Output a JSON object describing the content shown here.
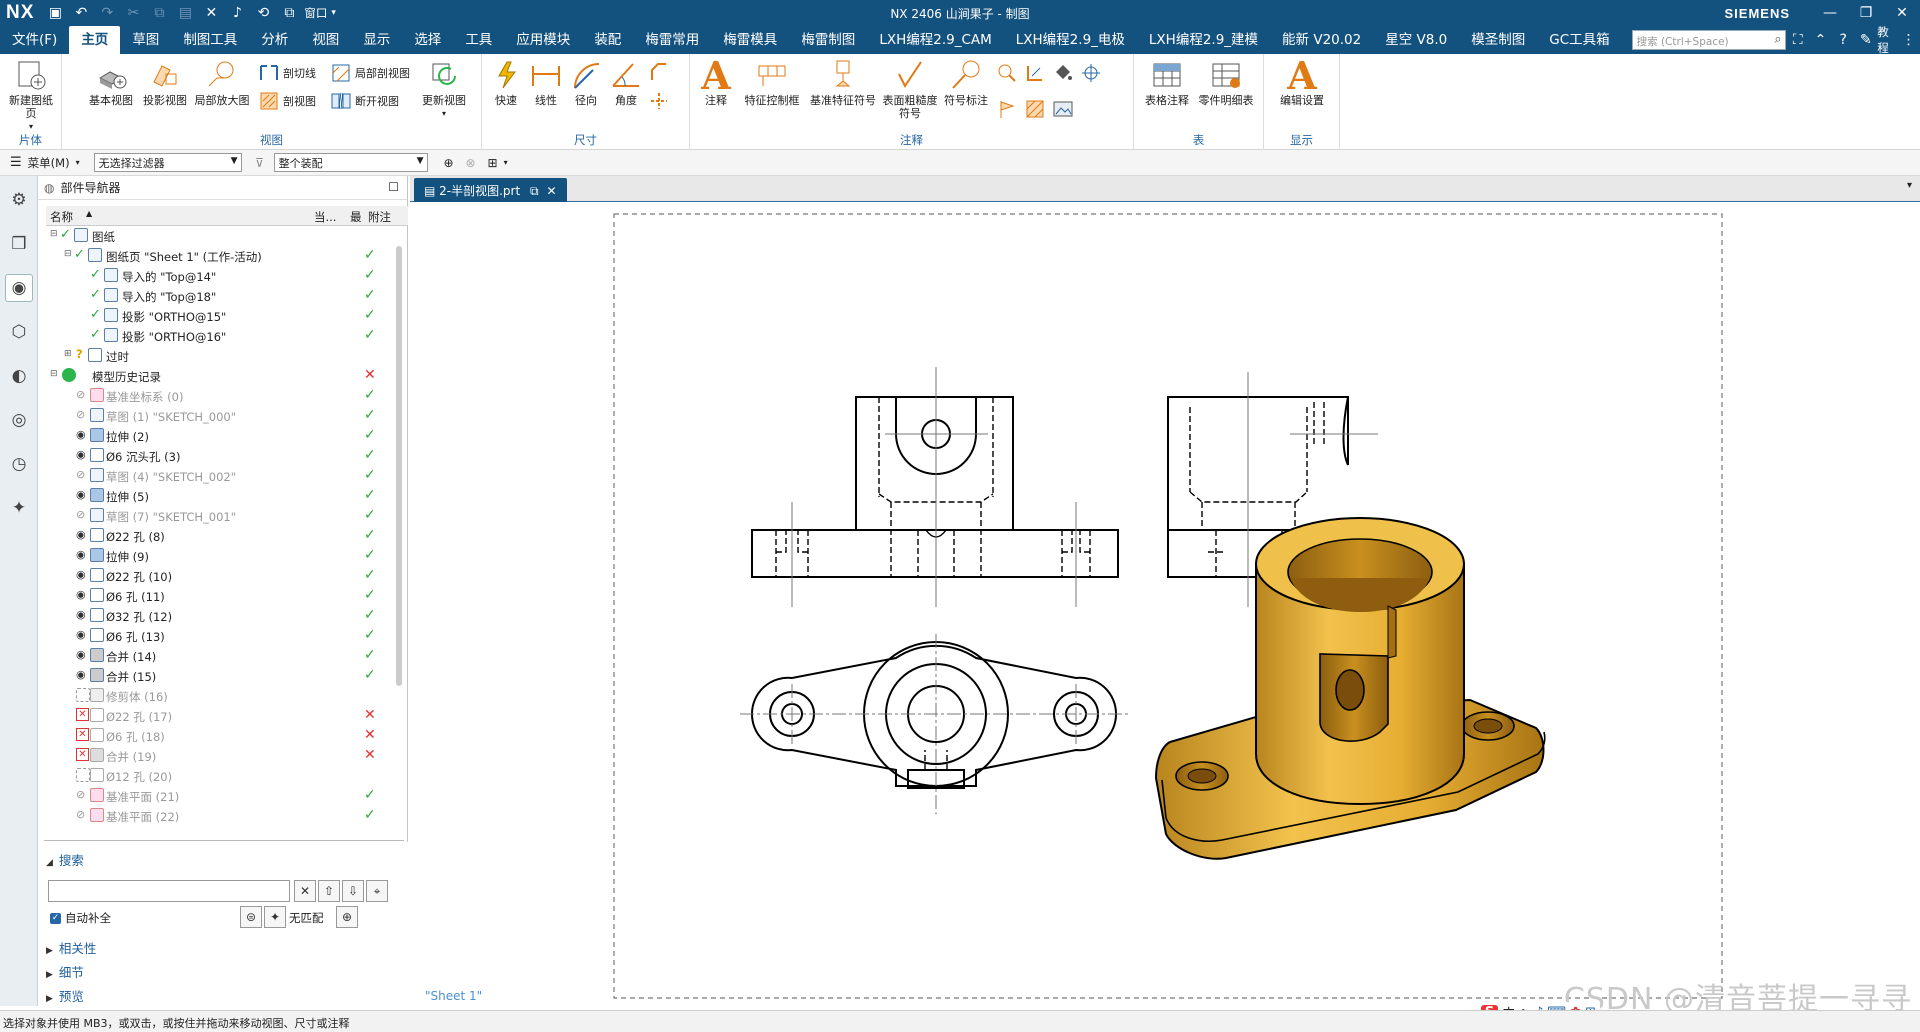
{
  "titlebar": {
    "logo": "NX",
    "window_menu": "窗口",
    "title": "NX 2406 山涧果子 - 制图",
    "brand": "SIEMENS"
  },
  "menubar": {
    "items": [
      "文件(F)",
      "主页",
      "草图",
      "制图工具",
      "分析",
      "视图",
      "显示",
      "选择",
      "工具",
      "应用模块",
      "装配",
      "梅雷常用",
      "梅雷模具",
      "梅雷制图",
      "LXH编程2.9_CAM",
      "LXH编程2.9_电极",
      "LXH编程2.9_建模",
      "能新 V20.02",
      "星空 V8.0",
      "模圣制图",
      "GC工具箱"
    ],
    "active_index": 1,
    "search_placeholder": "搜索 (Ctrl+Space)",
    "tutorial": "教程"
  },
  "ribbon": {
    "new_sheet": "新建图纸页",
    "group_piece": "片体",
    "base_view": "基本视图",
    "projected_view": "投影视图",
    "detail_view": "局部放大图",
    "section_line": "剖切线",
    "local_section": "局部剖视图",
    "section_view": "剖视图",
    "broken_view": "断开视图",
    "update_view": "更新视图",
    "group_view": "视图",
    "rapid": "快速",
    "linear": "线性",
    "radial": "径向",
    "angle": "角度",
    "group_dim": "尺寸",
    "note": "注释",
    "fcf": "特征控制框",
    "datum_symbol": "基准特征符号",
    "surface_finish": "表面粗糙度符号",
    "symbol_note": "符号标注",
    "group_annot": "注释",
    "table_note": "表格注释",
    "parts_list": "零件明细表",
    "group_table": "表",
    "edit_settings": "编辑设置",
    "group_display": "显示"
  },
  "selbar": {
    "menu": "菜单(M)",
    "filter": "无选择过滤器",
    "scope": "整个装配"
  },
  "navigator": {
    "title": "部件导航器",
    "col_name": "名称",
    "col_current": "当...",
    "col_latest": "最",
    "col_attach": "附注",
    "rows": [
      {
        "label": "图纸",
        "status": "",
        "gray": false
      },
      {
        "label": "图纸页 \"Sheet 1\" (工作-活动)",
        "status": "ok",
        "gray": false
      },
      {
        "label": "导入的 \"Top@14\"",
        "status": "ok",
        "gray": false
      },
      {
        "label": "导入的 \"Top@18\"",
        "status": "ok",
        "gray": false
      },
      {
        "label": "投影 \"ORTHO@15\"",
        "status": "ok",
        "gray": false
      },
      {
        "label": "投影 \"ORTHO@16\"",
        "status": "ok",
        "gray": false
      },
      {
        "label": "过时",
        "status": "",
        "gray": false
      },
      {
        "label": "模型历史记录",
        "status": "bad",
        "gray": false
      },
      {
        "label": "基准坐标系 (0)",
        "status": "ok",
        "gray": true
      },
      {
        "label": "草图 (1) \"SKETCH_000\"",
        "status": "ok",
        "gray": true
      },
      {
        "label": "拉伸 (2)",
        "status": "ok",
        "gray": false
      },
      {
        "label": "Ø6 沉头孔 (3)",
        "status": "ok",
        "gray": false
      },
      {
        "label": "草图 (4) \"SKETCH_002\"",
        "status": "ok",
        "gray": true
      },
      {
        "label": "拉伸 (5)",
        "status": "ok",
        "gray": false
      },
      {
        "label": "草图 (7) \"SKETCH_001\"",
        "status": "ok",
        "gray": true
      },
      {
        "label": "Ø22 孔 (8)",
        "status": "ok",
        "gray": false
      },
      {
        "label": "拉伸 (9)",
        "status": "ok",
        "gray": false
      },
      {
        "label": "Ø22 孔 (10)",
        "status": "ok",
        "gray": false
      },
      {
        "label": "Ø6 孔 (11)",
        "status": "ok",
        "gray": false
      },
      {
        "label": "Ø32 孔 (12)",
        "status": "ok",
        "gray": false
      },
      {
        "label": "Ø6 孔 (13)",
        "status": "ok",
        "gray": false
      },
      {
        "label": "合并 (14)",
        "status": "ok",
        "gray": false
      },
      {
        "label": "合并 (15)",
        "status": "ok",
        "gray": false
      },
      {
        "label": "修剪体 (16)",
        "status": "",
        "gray": true
      },
      {
        "label": "Ø22 孔 (17)",
        "status": "bad",
        "gray": true
      },
      {
        "label": "Ø6 孔 (18)",
        "status": "bad",
        "gray": true
      },
      {
        "label": "合并 (19)",
        "status": "bad",
        "gray": true
      },
      {
        "label": "Ø12 孔 (20)",
        "status": "",
        "gray": true
      },
      {
        "label": "基准平面 (21)",
        "status": "ok",
        "gray": true
      },
      {
        "label": "基准平面 (22)",
        "status": "ok",
        "gray": true
      }
    ]
  },
  "search": {
    "title": "搜索",
    "autocomplete": "自动补全",
    "no_match": "无匹配",
    "sections": [
      "相关性",
      "细节",
      "预览"
    ]
  },
  "document": {
    "tab": "2-半剖视图.prt",
    "sheet_label": "\"Sheet 1\""
  },
  "status": {
    "message": "选择对象并使用 MB3，或双击，或按住并拖动来移动视图、尺寸或注释"
  },
  "watermark": "CSDN @清音菩提一寻寻",
  "colors": {
    "titlebar": "#13517e",
    "accent": "#2767a6",
    "model": "#e8b33a",
    "ok": "#29a63c",
    "bad": "#e03030"
  }
}
